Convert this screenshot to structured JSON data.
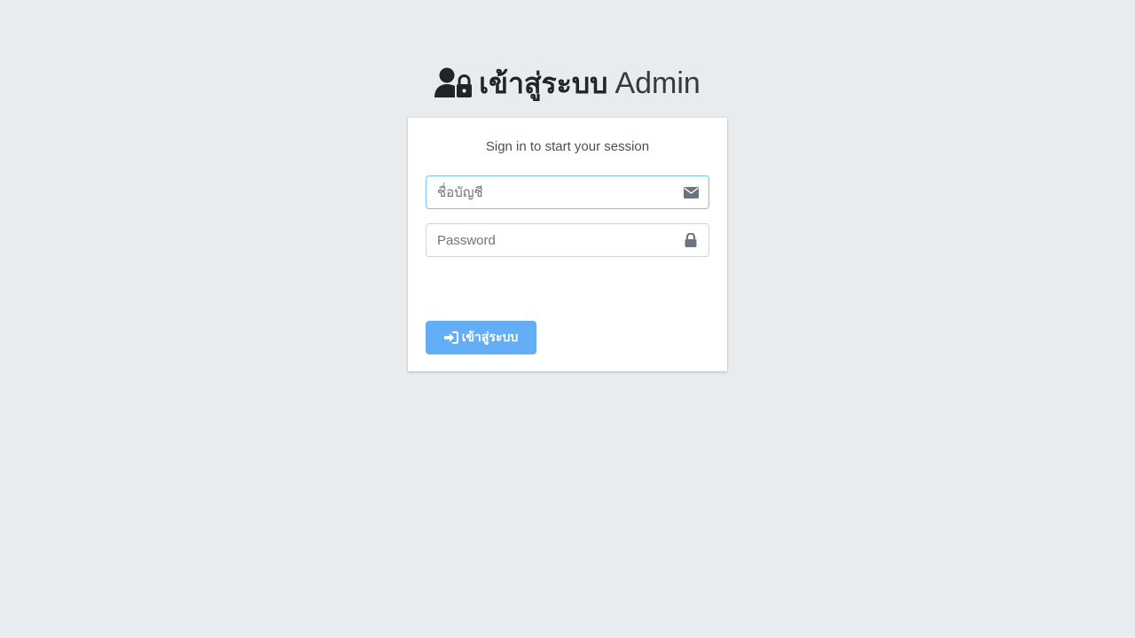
{
  "header": {
    "title_strong": "เข้าสู่ระบบ",
    "title_light": "Admin",
    "icon": "user-lock-icon"
  },
  "login": {
    "message": "Sign in to start your session",
    "username": {
      "placeholder": "ชื่อบัญชี",
      "value": "",
      "icon": "envelope-icon"
    },
    "password": {
      "placeholder": "Password",
      "value": "",
      "icon": "lock-icon"
    },
    "submit": {
      "label": "เข้าสู่ระบบ",
      "icon": "sign-in-icon"
    }
  },
  "colors": {
    "background": "#e9ecef",
    "button": "#63aef7",
    "text_dark": "#212529"
  }
}
